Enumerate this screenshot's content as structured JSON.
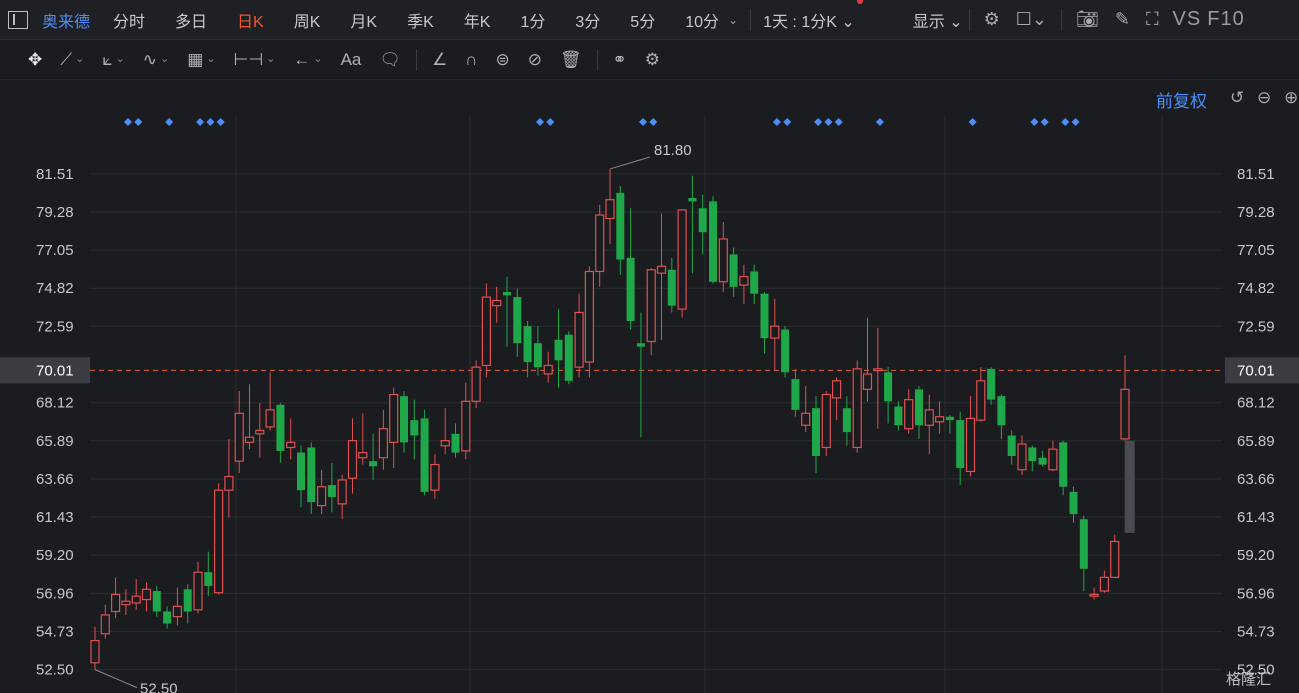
{
  "toolbar": {
    "stock_name": "奥来德",
    "periods": [
      "分时",
      "多日",
      "日K",
      "周K",
      "月K",
      "季K",
      "年K",
      "1分",
      "3分",
      "5分",
      "10分"
    ],
    "active_period": "日K",
    "range_selector": "1天 : 1分K",
    "display_label": "显示",
    "vs_label": "VS",
    "f10_label": "F10"
  },
  "chart_panel": {
    "adjust_label": "前复权",
    "watermark": "格隆汇"
  },
  "colors": {
    "background": "#1b1c1f",
    "up": "#e05050",
    "down": "#1fa84a",
    "grid": "#2a2b2f",
    "axis_text": "#c8c8cc",
    "price_line": "#e0603a",
    "marker": "#4c8ef7",
    "current_box": "#3c3d42"
  },
  "chart_data": {
    "type": "candlestick",
    "y_ticks": [
      52.5,
      54.73,
      56.96,
      59.2,
      61.43,
      63.66,
      65.89,
      68.12,
      70.01,
      72.59,
      74.82,
      77.05,
      79.28,
      81.51
    ],
    "y_range": [
      51.6,
      83.2
    ],
    "current_price": 70.01,
    "high_annotation": "81.80",
    "low_annotation": "52.50",
    "grid": true,
    "event_marker_positions": [
      0,
      1,
      4,
      7,
      8,
      9,
      40,
      41,
      50,
      51,
      63,
      64,
      67,
      68,
      69,
      73,
      82,
      88,
      89,
      91,
      92
    ],
    "candles": [
      {
        "o": 52.9,
        "c": 54.2,
        "h": 55.0,
        "l": 52.5
      },
      {
        "o": 54.6,
        "c": 55.7,
        "h": 56.3,
        "l": 54.3
      },
      {
        "o": 55.9,
        "c": 56.9,
        "h": 57.9,
        "l": 55.5
      },
      {
        "o": 56.3,
        "c": 56.5,
        "h": 57.2,
        "l": 55.7
      },
      {
        "o": 56.4,
        "c": 56.8,
        "h": 57.8,
        "l": 56.0
      },
      {
        "o": 56.6,
        "c": 57.2,
        "h": 57.6,
        "l": 55.9
      },
      {
        "o": 57.1,
        "c": 55.9,
        "h": 57.4,
        "l": 55.6
      },
      {
        "o": 55.9,
        "c": 55.2,
        "h": 56.2,
        "l": 54.9
      },
      {
        "o": 55.6,
        "c": 56.2,
        "h": 57.3,
        "l": 55.1
      },
      {
        "o": 57.2,
        "c": 55.9,
        "h": 57.5,
        "l": 55.2
      },
      {
        "o": 56.0,
        "c": 58.2,
        "h": 58.8,
        "l": 55.8
      },
      {
        "o": 58.2,
        "c": 57.4,
        "h": 59.4,
        "l": 56.8
      },
      {
        "o": 57.0,
        "c": 63.0,
        "h": 63.4,
        "l": 56.9
      },
      {
        "o": 63.0,
        "c": 63.8,
        "h": 66.0,
        "l": 61.4
      },
      {
        "o": 64.7,
        "c": 67.5,
        "h": 68.8,
        "l": 64.0
      },
      {
        "o": 65.8,
        "c": 66.1,
        "h": 69.2,
        "l": 65.4
      },
      {
        "o": 66.3,
        "c": 66.5,
        "h": 68.1,
        "l": 64.9
      },
      {
        "o": 66.7,
        "c": 67.7,
        "h": 69.9,
        "l": 66.5
      },
      {
        "o": 68.0,
        "c": 65.3,
        "h": 68.1,
        "l": 64.6
      },
      {
        "o": 65.5,
        "c": 65.8,
        "h": 67.2,
        "l": 64.8
      },
      {
        "o": 65.2,
        "c": 63.0,
        "h": 65.6,
        "l": 62.0
      },
      {
        "o": 65.5,
        "c": 62.3,
        "h": 65.8,
        "l": 61.6
      },
      {
        "o": 62.1,
        "c": 63.2,
        "h": 64.2,
        "l": 61.6
      },
      {
        "o": 63.3,
        "c": 62.6,
        "h": 64.6,
        "l": 61.7
      },
      {
        "o": 62.2,
        "c": 63.6,
        "h": 63.9,
        "l": 61.3
      },
      {
        "o": 63.7,
        "c": 65.9,
        "h": 67.2,
        "l": 62.8
      },
      {
        "o": 64.9,
        "c": 65.2,
        "h": 67.5,
        "l": 64.5
      },
      {
        "o": 64.7,
        "c": 64.4,
        "h": 66.3,
        "l": 63.6
      },
      {
        "o": 64.9,
        "c": 66.6,
        "h": 67.7,
        "l": 64.2
      },
      {
        "o": 65.8,
        "c": 68.6,
        "h": 69.0,
        "l": 64.3
      },
      {
        "o": 68.5,
        "c": 65.8,
        "h": 68.8,
        "l": 65.2
      },
      {
        "o": 67.1,
        "c": 66.2,
        "h": 68.3,
        "l": 64.8
      },
      {
        "o": 67.2,
        "c": 62.9,
        "h": 67.7,
        "l": 62.7
      },
      {
        "o": 63.0,
        "c": 64.5,
        "h": 65.1,
        "l": 62.5
      },
      {
        "o": 65.6,
        "c": 65.9,
        "h": 67.8,
        "l": 65.1
      },
      {
        "o": 66.3,
        "c": 65.2,
        "h": 66.9,
        "l": 64.9
      },
      {
        "o": 65.3,
        "c": 68.2,
        "h": 69.3,
        "l": 64.8
      },
      {
        "o": 68.2,
        "c": 70.2,
        "h": 70.6,
        "l": 67.8
      },
      {
        "o": 70.3,
        "c": 74.3,
        "h": 75.1,
        "l": 69.6
      },
      {
        "o": 73.8,
        "c": 74.1,
        "h": 74.9,
        "l": 72.8
      },
      {
        "o": 74.6,
        "c": 74.4,
        "h": 75.5,
        "l": 71.4
      },
      {
        "o": 74.3,
        "c": 71.6,
        "h": 74.8,
        "l": 70.8
      },
      {
        "o": 72.6,
        "c": 70.5,
        "h": 72.9,
        "l": 69.6
      },
      {
        "o": 71.6,
        "c": 70.2,
        "h": 72.6,
        "l": 69.7
      },
      {
        "o": 69.8,
        "c": 70.3,
        "h": 71.1,
        "l": 69.3
      },
      {
        "o": 71.8,
        "c": 70.6,
        "h": 73.6,
        "l": 69.0
      },
      {
        "o": 72.1,
        "c": 69.4,
        "h": 72.3,
        "l": 69.2
      },
      {
        "o": 70.2,
        "c": 73.4,
        "h": 74.5,
        "l": 69.6
      },
      {
        "o": 70.5,
        "c": 75.8,
        "h": 76.1,
        "l": 69.6
      },
      {
        "o": 75.8,
        "c": 79.1,
        "h": 79.7,
        "l": 74.9
      },
      {
        "o": 78.9,
        "c": 80.0,
        "h": 81.8,
        "l": 77.4
      },
      {
        "o": 80.4,
        "c": 76.5,
        "h": 80.8,
        "l": 75.6
      },
      {
        "o": 76.6,
        "c": 72.9,
        "h": 79.5,
        "l": 72.4
      },
      {
        "o": 71.6,
        "c": 71.4,
        "h": 73.4,
        "l": 66.1
      },
      {
        "o": 71.7,
        "c": 75.9,
        "h": 76.0,
        "l": 70.9
      },
      {
        "o": 75.7,
        "c": 76.1,
        "h": 79.2,
        "l": 71.8
      },
      {
        "o": 75.9,
        "c": 73.8,
        "h": 76.6,
        "l": 73.4
      },
      {
        "o": 73.6,
        "c": 79.4,
        "h": 79.4,
        "l": 73.1
      },
      {
        "o": 80.1,
        "c": 79.9,
        "h": 81.4,
        "l": 75.7
      },
      {
        "o": 79.5,
        "c": 78.1,
        "h": 80.3,
        "l": 76.8
      },
      {
        "o": 79.9,
        "c": 75.2,
        "h": 80.2,
        "l": 75.1
      },
      {
        "o": 75.2,
        "c": 77.7,
        "h": 78.7,
        "l": 74.6
      },
      {
        "o": 76.8,
        "c": 74.9,
        "h": 77.2,
        "l": 74.3
      },
      {
        "o": 75.0,
        "c": 75.5,
        "h": 76.2,
        "l": 73.9
      },
      {
        "o": 75.8,
        "c": 74.5,
        "h": 76.2,
        "l": 73.9
      },
      {
        "o": 74.5,
        "c": 71.9,
        "h": 74.6,
        "l": 71.0
      },
      {
        "o": 71.9,
        "c": 72.6,
        "h": 74.2,
        "l": 70.0
      },
      {
        "o": 72.4,
        "c": 69.9,
        "h": 72.6,
        "l": 69.6
      },
      {
        "o": 69.5,
        "c": 67.7,
        "h": 70.1,
        "l": 67.3
      },
      {
        "o": 66.8,
        "c": 67.5,
        "h": 69.1,
        "l": 66.4
      },
      {
        "o": 67.8,
        "c": 65.0,
        "h": 68.5,
        "l": 64.0
      },
      {
        "o": 65.5,
        "c": 68.6,
        "h": 68.8,
        "l": 65.0
      },
      {
        "o": 68.4,
        "c": 69.4,
        "h": 69.6,
        "l": 67.1
      },
      {
        "o": 67.8,
        "c": 66.4,
        "h": 68.5,
        "l": 65.6
      },
      {
        "o": 65.5,
        "c": 70.1,
        "h": 70.6,
        "l": 65.2
      },
      {
        "o": 68.9,
        "c": 69.8,
        "h": 73.1,
        "l": 68.2
      },
      {
        "o": 70.0,
        "c": 70.1,
        "h": 72.5,
        "l": 66.6
      },
      {
        "o": 69.9,
        "c": 68.2,
        "h": 70.2,
        "l": 66.9
      },
      {
        "o": 67.9,
        "c": 66.8,
        "h": 68.2,
        "l": 66.5
      },
      {
        "o": 66.6,
        "c": 68.3,
        "h": 68.9,
        "l": 66.3
      },
      {
        "o": 68.9,
        "c": 66.8,
        "h": 69.1,
        "l": 66.0
      },
      {
        "o": 66.8,
        "c": 67.7,
        "h": 68.6,
        "l": 65.1
      },
      {
        "o": 67.0,
        "c": 67.3,
        "h": 68.2,
        "l": 66.3
      },
      {
        "o": 67.3,
        "c": 67.1,
        "h": 67.4,
        "l": 66.3
      },
      {
        "o": 67.1,
        "c": 64.3,
        "h": 67.6,
        "l": 63.3
      },
      {
        "o": 64.1,
        "c": 67.2,
        "h": 68.5,
        "l": 63.8
      },
      {
        "o": 67.1,
        "c": 69.4,
        "h": 70.2,
        "l": 67.0
      },
      {
        "o": 70.1,
        "c": 68.3,
        "h": 70.2,
        "l": 68.0
      },
      {
        "o": 68.5,
        "c": 66.8,
        "h": 68.6,
        "l": 66.0
      },
      {
        "o": 66.2,
        "c": 65.0,
        "h": 66.5,
        "l": 64.5
      },
      {
        "o": 64.2,
        "c": 65.7,
        "h": 66.2,
        "l": 63.9
      },
      {
        "o": 65.5,
        "c": 64.7,
        "h": 65.6,
        "l": 64.1
      },
      {
        "o": 64.9,
        "c": 64.5,
        "h": 65.3,
        "l": 64.4
      },
      {
        "o": 64.2,
        "c": 65.4,
        "h": 65.9,
        "l": 64.1
      },
      {
        "o": 65.8,
        "c": 63.2,
        "h": 65.9,
        "l": 62.7
      },
      {
        "o": 62.9,
        "c": 61.6,
        "h": 63.2,
        "l": 61.1
      },
      {
        "o": 61.3,
        "c": 58.4,
        "h": 61.5,
        "l": 57.1
      },
      {
        "o": 56.8,
        "c": 56.9,
        "h": 57.3,
        "l": 56.6
      },
      {
        "o": 57.1,
        "c": 57.9,
        "h": 58.3,
        "l": 57.0
      },
      {
        "o": 57.9,
        "c": 60.0,
        "h": 60.4,
        "l": 57.9
      },
      {
        "o": 66.0,
        "c": 68.9,
        "h": 70.9,
        "l": 65.9
      }
    ]
  }
}
